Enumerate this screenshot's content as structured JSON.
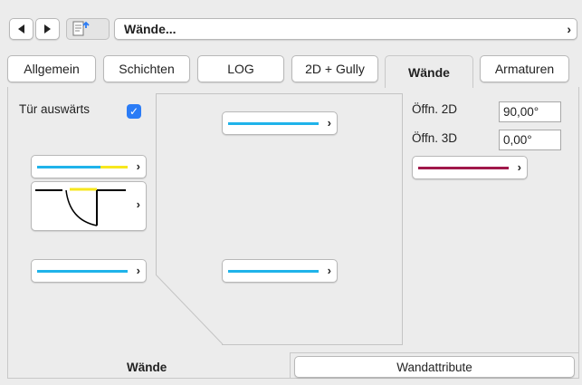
{
  "nav": {
    "title": "Wände...",
    "doc_icon": "document-arrow-icon"
  },
  "tabs": [
    {
      "label": "Allgemein",
      "active": false
    },
    {
      "label": "Schichten",
      "active": false
    },
    {
      "label": "LOG",
      "active": false
    },
    {
      "label": "2D + Gully",
      "active": false
    },
    {
      "label": "Wände",
      "active": true
    },
    {
      "label": "Armaturen",
      "active": false
    }
  ],
  "left": {
    "door_outward_label": "Tür auswärts",
    "door_outward_checked": true
  },
  "right": {
    "opening_2d_label": "Öffn. 2D",
    "opening_2d_value": "90,00°",
    "opening_3d_label": "Öffn. 3D",
    "opening_3d_value": "0,00°"
  },
  "bottom": {
    "wall_label": "Wände",
    "wall_attributes_button": "Wandattribute"
  },
  "colors": {
    "blue_line": "#1fb3ea",
    "yellow_line": "#f7e71e",
    "red_line": "#a0184a",
    "checkbox": "#2b7cf6"
  }
}
